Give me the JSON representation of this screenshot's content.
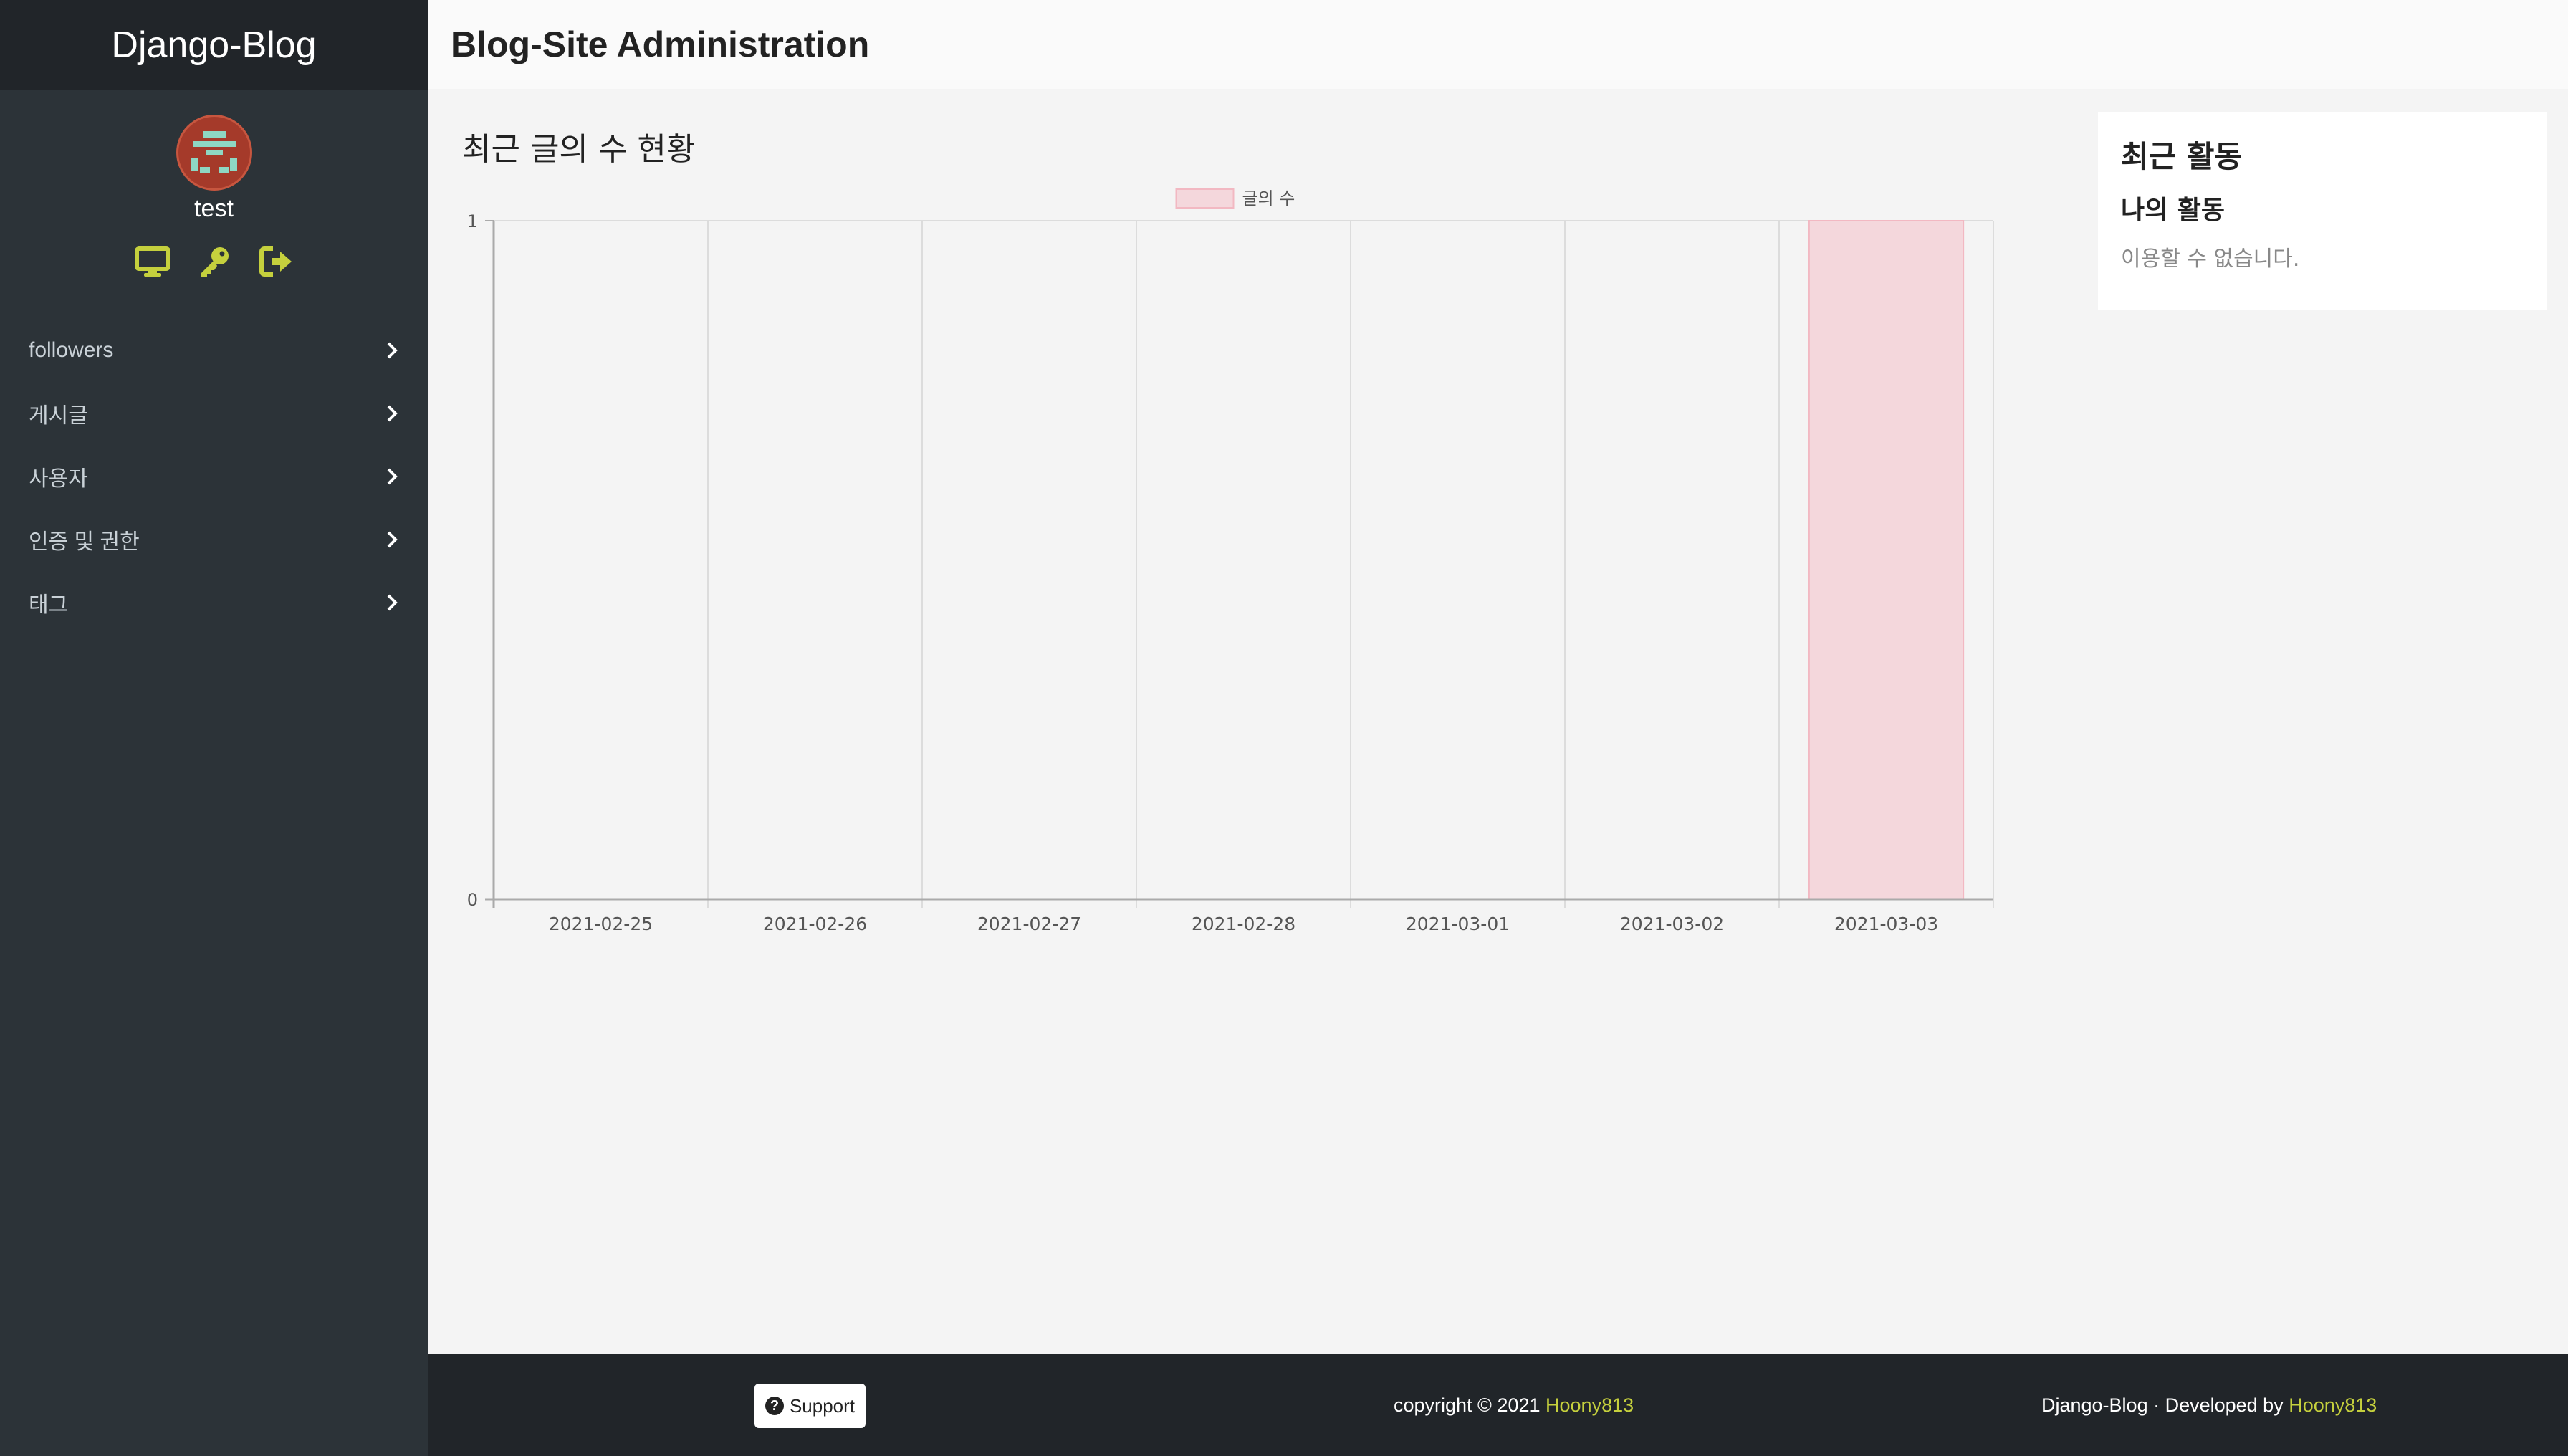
{
  "sidebar": {
    "brand": "Django-Blog",
    "username": "test",
    "quick_icons": [
      "monitor-icon",
      "key-icon",
      "sign-out-icon"
    ],
    "items": [
      {
        "label": "followers"
      },
      {
        "label": "게시글"
      },
      {
        "label": "사용자"
      },
      {
        "label": "인증 및 권한"
      },
      {
        "label": "태그"
      }
    ]
  },
  "header": {
    "title": "Blog-Site Administration"
  },
  "main": {
    "chart_heading": "최근 글의 수 현황"
  },
  "chart_data": {
    "type": "bar",
    "categories": [
      "2021-02-25",
      "2021-02-26",
      "2021-02-27",
      "2021-02-28",
      "2021-03-01",
      "2021-03-02",
      "2021-03-03"
    ],
    "series": [
      {
        "name": "글의 수",
        "values": [
          0,
          0,
          0,
          0,
          0,
          0,
          1
        ]
      }
    ],
    "ylim": [
      0,
      1
    ],
    "yticks": [
      "0",
      "1"
    ],
    "grid": true,
    "legend": "top-center",
    "colors": {
      "bar_fill": "#f4d7dc",
      "bar_stroke": "#f2b8c2"
    }
  },
  "activity": {
    "title": "최근 활동",
    "subtitle": "나의 활동",
    "empty_text": "이용할 수 없습니다."
  },
  "footer": {
    "support_label": "Support",
    "copyright_prefix": "copyright © 2021 ",
    "copyright_link": "Hoony813",
    "credits_prefix": "Django-Blog · Developed by ",
    "credits_link": "Hoony813"
  },
  "colors": {
    "accent": "#c5d03d",
    "sidebar_bg": "#2c3338",
    "footer_bg": "#212529"
  }
}
